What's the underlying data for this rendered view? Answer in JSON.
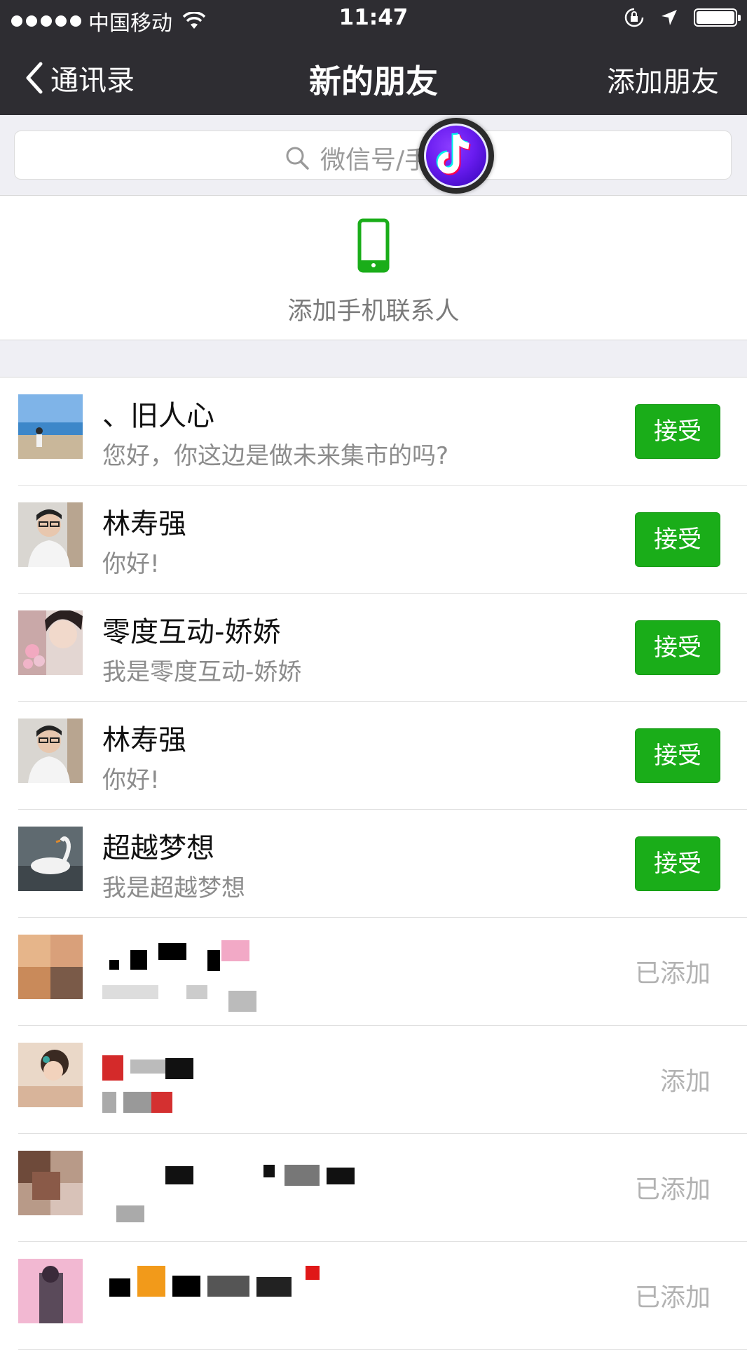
{
  "status_bar": {
    "carrier": "中国移动",
    "time": "11:47",
    "battery_level": 1.0
  },
  "nav": {
    "back_label": "通讯录",
    "title": "新的朋友",
    "right_action": "添加朋友"
  },
  "search": {
    "placeholder": "微信号/手"
  },
  "add_contacts": {
    "label": "添加手机联系人"
  },
  "requests": [
    {
      "name": "、旧人心",
      "message": "您好，你这边是做未来集市的吗?",
      "action": "接受"
    },
    {
      "name": "林寿强",
      "message": "你好!",
      "action": "接受"
    },
    {
      "name": "零度互动-娇娇",
      "message": "我是零度互动-娇娇",
      "action": "接受"
    },
    {
      "name": "林寿强",
      "message": "你好!",
      "action": "接受"
    },
    {
      "name": "超越梦想",
      "message": "我是超越梦想",
      "action": "接受"
    },
    {
      "name": "",
      "message": "",
      "action": "已添加"
    },
    {
      "name": "",
      "message": "",
      "action": "添加"
    },
    {
      "name": "",
      "message": "",
      "action": "已添加"
    },
    {
      "name": "",
      "message": "",
      "action": "已添加"
    }
  ],
  "colors": {
    "nav_bg": "#2e2d32",
    "accept_green": "#1aad19",
    "page_bg": "#efeff4"
  }
}
